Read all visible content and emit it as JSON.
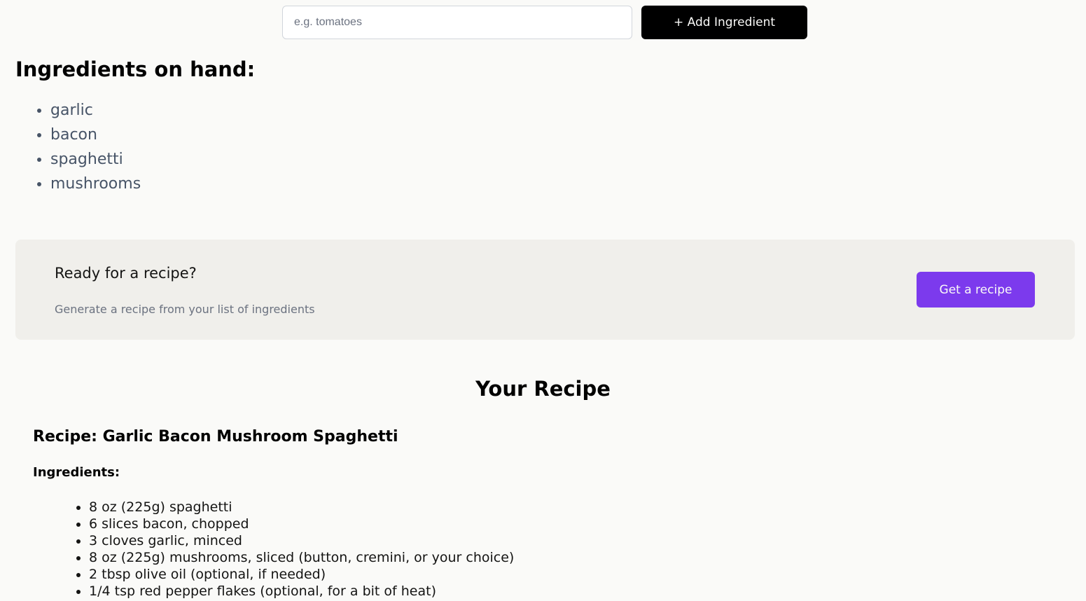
{
  "add_form": {
    "input_placeholder": "e.g. tomatoes",
    "input_value": "",
    "button_label": "+ Add Ingredient"
  },
  "ingredients": {
    "title": "Ingredients on hand:",
    "items": [
      "garlic",
      "bacon",
      "spaghetti",
      "mushrooms"
    ]
  },
  "cta": {
    "heading": "Ready for a recipe?",
    "subtext": "Generate a recipe from your list of ingredients",
    "button_label": "Get a recipe",
    "button_color": "#7c3aed",
    "panel_color": "#f0efeb"
  },
  "recipe": {
    "section_title": "Your Recipe",
    "name": "Recipe: Garlic Bacon Mushroom Spaghetti",
    "ingredients_heading": "Ingredients:",
    "ingredients": [
      "8 oz (225g) spaghetti",
      "6 slices bacon, chopped",
      "3 cloves garlic, minced",
      "8 oz (225g) mushrooms, sliced (button, cremini, or your choice)",
      "2 tbsp olive oil (optional, if needed)",
      "1/4 tsp red pepper flakes (optional, for a bit of heat)"
    ]
  }
}
